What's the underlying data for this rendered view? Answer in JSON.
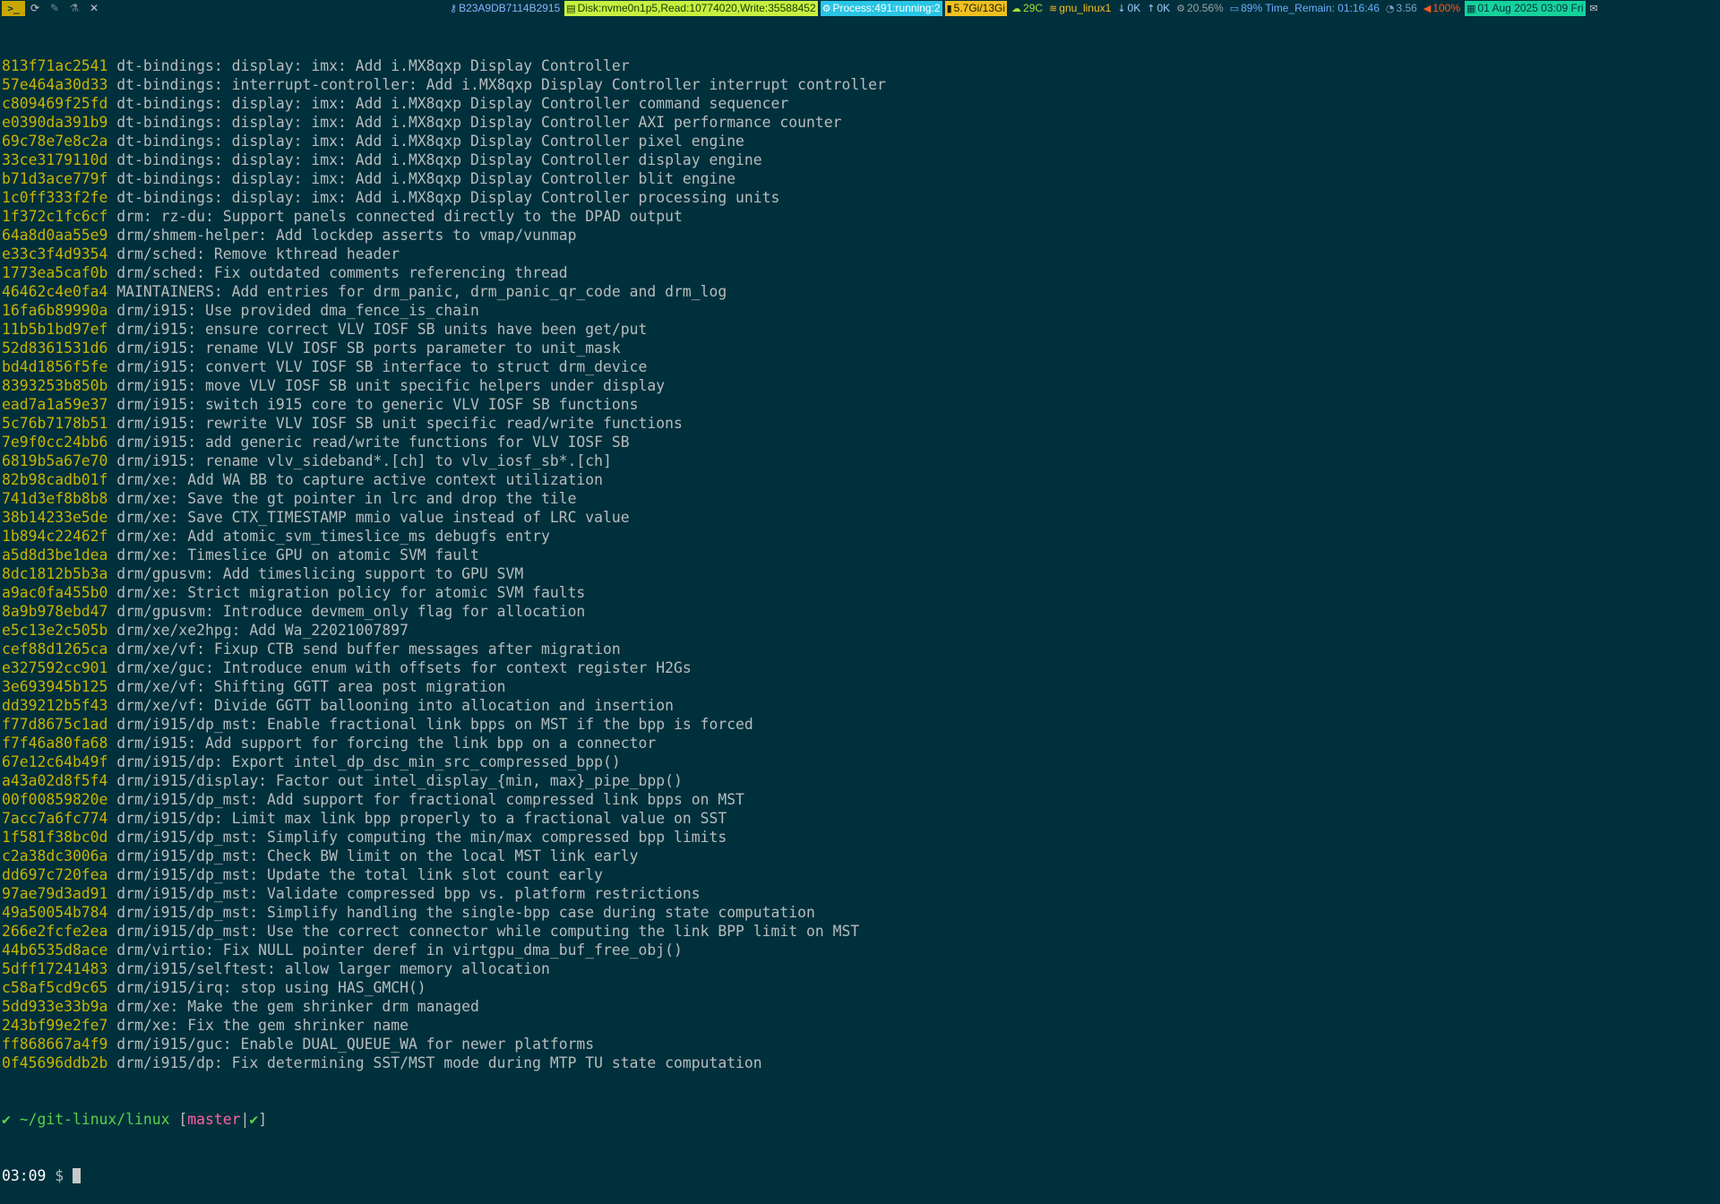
{
  "statusbar": {
    "left_icons": [
      "terminal-icon",
      "refresh-icon",
      "pen-icon",
      "flask-icon",
      "tools-icon"
    ],
    "key_label": "B23A9DB7114B2915",
    "disk": "Disk:nvme0n1p5,Read:10774020,Write:35588452",
    "process": "Process:491:running:2",
    "memory": "5.7Gi/13Gi",
    "temperature": "29C",
    "network": "gnu_linux1",
    "down": "0K",
    "up": "0K",
    "cpu": "20.56%",
    "battery": "89% Time_Remain: 01:16:46",
    "load": "3.56",
    "volume": "100%",
    "datetime": "01 Aug 2025 03:09 Fri"
  },
  "commits": [
    {
      "hash": "813f71ac2541",
      "msg": "dt-bindings: display: imx: Add i.MX8qxp Display Controller"
    },
    {
      "hash": "57e464a30d33",
      "msg": "dt-bindings: interrupt-controller: Add i.MX8qxp Display Controller interrupt controller"
    },
    {
      "hash": "c809469f25fd",
      "msg": "dt-bindings: display: imx: Add i.MX8qxp Display Controller command sequencer"
    },
    {
      "hash": "e0390da391b9",
      "msg": "dt-bindings: display: imx: Add i.MX8qxp Display Controller AXI performance counter"
    },
    {
      "hash": "69c78e7e8c2a",
      "msg": "dt-bindings: display: imx: Add i.MX8qxp Display Controller pixel engine"
    },
    {
      "hash": "33ce3179110d",
      "msg": "dt-bindings: display: imx: Add i.MX8qxp Display Controller display engine"
    },
    {
      "hash": "b71d3ace779f",
      "msg": "dt-bindings: display: imx: Add i.MX8qxp Display Controller blit engine"
    },
    {
      "hash": "1c0ff333f2fe",
      "msg": "dt-bindings: display: imx: Add i.MX8qxp Display Controller processing units"
    },
    {
      "hash": "1f372c1fc6cf",
      "msg": "drm: rz-du: Support panels connected directly to the DPAD output"
    },
    {
      "hash": "64a8d0aa55e9",
      "msg": "drm/shmem-helper: Add lockdep asserts to vmap/vunmap"
    },
    {
      "hash": "e33c3f4d9354",
      "msg": "drm/sched: Remove kthread header"
    },
    {
      "hash": "1773ea5caf0b",
      "msg": "drm/sched: Fix outdated comments referencing thread"
    },
    {
      "hash": "46462c4e0fa4",
      "msg": "MAINTAINERS: Add entries for drm_panic, drm_panic_qr_code and drm_log"
    },
    {
      "hash": "16fa6b89990a",
      "msg": "drm/i915: Use provided dma_fence_is_chain"
    },
    {
      "hash": "11b5b1bd97ef",
      "msg": "drm/i915: ensure correct VLV IOSF SB units have been get/put"
    },
    {
      "hash": "52d8361531d6",
      "msg": "drm/i915: rename VLV IOSF SB ports parameter to unit_mask"
    },
    {
      "hash": "bd4d1856f5fe",
      "msg": "drm/i915: convert VLV IOSF SB interface to struct drm_device"
    },
    {
      "hash": "8393253b850b",
      "msg": "drm/i915: move VLV IOSF SB unit specific helpers under display"
    },
    {
      "hash": "ead7a1a59e37",
      "msg": "drm/i915: switch i915 core to generic VLV IOSF SB functions"
    },
    {
      "hash": "5c76b7178b51",
      "msg": "drm/i915: rewrite VLV IOSF SB unit specific read/write functions"
    },
    {
      "hash": "7e9f0cc24bb6",
      "msg": "drm/i915: add generic read/write functions for VLV IOSF SB"
    },
    {
      "hash": "6819b5a67e70",
      "msg": "drm/i915: rename vlv_sideband*.[ch] to vlv_iosf_sb*.[ch]"
    },
    {
      "hash": "82b98cadb01f",
      "msg": "drm/xe: Add WA BB to capture active context utilization"
    },
    {
      "hash": "741d3ef8b8b8",
      "msg": "drm/xe: Save the gt pointer in lrc and drop the tile"
    },
    {
      "hash": "38b14233e5de",
      "msg": "drm/xe: Save CTX_TIMESTAMP mmio value instead of LRC value"
    },
    {
      "hash": "1b894c22462f",
      "msg": "drm/xe: Add atomic_svm_timeslice_ms debugfs entry"
    },
    {
      "hash": "a5d8d3be1dea",
      "msg": "drm/xe: Timeslice GPU on atomic SVM fault"
    },
    {
      "hash": "8dc1812b5b3a",
      "msg": "drm/gpusvm: Add timeslicing support to GPU SVM"
    },
    {
      "hash": "a9ac0fa455b0",
      "msg": "drm/xe: Strict migration policy for atomic SVM faults"
    },
    {
      "hash": "8a9b978ebd47",
      "msg": "drm/gpusvm: Introduce devmem_only flag for allocation"
    },
    {
      "hash": "e5c13e2c505b",
      "msg": "drm/xe/xe2hpg: Add Wa_22021007897"
    },
    {
      "hash": "cef88d1265ca",
      "msg": "drm/xe/vf: Fixup CTB send buffer messages after migration"
    },
    {
      "hash": "e327592cc901",
      "msg": "drm/xe/guc: Introduce enum with offsets for context register H2Gs"
    },
    {
      "hash": "3e693945b125",
      "msg": "drm/xe/vf: Shifting GGTT area post migration"
    },
    {
      "hash": "dd39212b5f43",
      "msg": "drm/xe/vf: Divide GGTT ballooning into allocation and insertion"
    },
    {
      "hash": "f77d8675c1ad",
      "msg": "drm/i915/dp_mst: Enable fractional link bpps on MST if the bpp is forced"
    },
    {
      "hash": "f7f46a80fa68",
      "msg": "drm/i915: Add support for forcing the link bpp on a connector"
    },
    {
      "hash": "67e12c64b49f",
      "msg": "drm/i915/dp: Export intel_dp_dsc_min_src_compressed_bpp()"
    },
    {
      "hash": "a43a02d8f5f4",
      "msg": "drm/i915/display: Factor out intel_display_{min, max}_pipe_bpp()"
    },
    {
      "hash": "00f00859820e",
      "msg": "drm/i915/dp_mst: Add support for fractional compressed link bpps on MST"
    },
    {
      "hash": "7acc7a6fc774",
      "msg": "drm/i915/dp: Limit max link bpp properly to a fractional value on SST"
    },
    {
      "hash": "1f581f38bc0d",
      "msg": "drm/i915/dp_mst: Simplify computing the min/max compressed bpp limits"
    },
    {
      "hash": "c2a38dc3006a",
      "msg": "drm/i915/dp_mst: Check BW limit on the local MST link early"
    },
    {
      "hash": "dd697c720fea",
      "msg": "drm/i915/dp_mst: Update the total link slot count early"
    },
    {
      "hash": "97ae79d3ad91",
      "msg": "drm/i915/dp_mst: Validate compressed bpp vs. platform restrictions"
    },
    {
      "hash": "49a50054b784",
      "msg": "drm/i915/dp_mst: Simplify handling the single-bpp case during state computation"
    },
    {
      "hash": "266e2fcfe2ea",
      "msg": "drm/i915/dp_mst: Use the correct connector while computing the link BPP limit on MST"
    },
    {
      "hash": "44b6535d8ace",
      "msg": "drm/virtio: Fix NULL pointer deref in virtgpu_dma_buf_free_obj()"
    },
    {
      "hash": "5dff17241483",
      "msg": "drm/i915/selftest: allow larger memory allocation"
    },
    {
      "hash": "c58af5cd9c65",
      "msg": "drm/i915/irq: stop using HAS_GMCH()"
    },
    {
      "hash": "5dd933e33b9a",
      "msg": "drm/xe: Make the gem shrinker drm managed"
    },
    {
      "hash": "243bf99e2fe7",
      "msg": "drm/xe: Fix the gem shrinker name"
    },
    {
      "hash": "ff868667a4f9",
      "msg": "drm/i915/guc: Enable DUAL_QUEUE_WA for newer platforms"
    },
    {
      "hash": "0f45696ddb2b",
      "msg": "drm/i915/dp: Fix determining SST/MST mode during MTP TU state computation"
    }
  ],
  "prompt": {
    "check": "✔",
    "path": "~/git-linux/linux",
    "branch": "master",
    "status": "✔",
    "time": "03:09",
    "symbol": "$"
  }
}
